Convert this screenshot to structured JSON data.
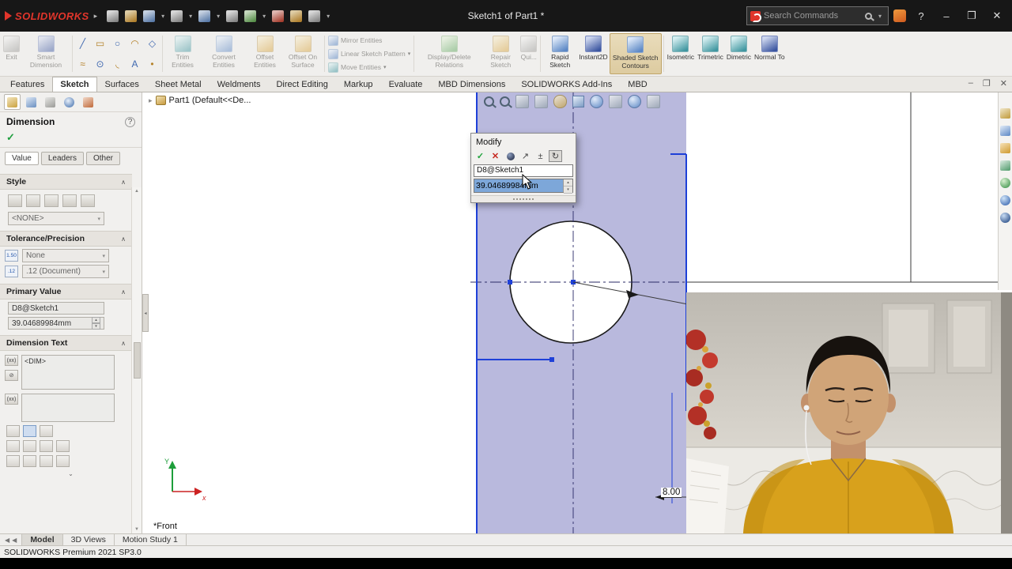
{
  "titlebar": {
    "app_name": "SOLIDWORKS",
    "title": "Sketch1 of Part1 *",
    "search_placeholder": "Search Commands"
  },
  "icons": {
    "flyout_arrow": "▸",
    "dropdown": "▾",
    "section_collapse": "∧",
    "panel_expand": "⌄",
    "check": "✓",
    "close": "✕",
    "minimize": "–",
    "restore": "❐",
    "question": "?",
    "scroll_up": "▲",
    "scroll_down": "▼",
    "nav_first": "◀",
    "nav_prev": "◀",
    "splitter_collapse": "◂",
    "spin_up": "▴",
    "spin_down": "▾",
    "arrow_ne": "↗",
    "plus_minus": "±",
    "spinner": "↻",
    "tools": [
      "╱",
      "▭",
      "○",
      "◠",
      "◇",
      "≈",
      "⊙",
      "◟",
      "A",
      "•"
    ]
  },
  "ribbon": {
    "buttons": [
      {
        "label": "Exit"
      },
      {
        "label": "Smart Dimension"
      },
      {
        "label": "Trim Entities"
      },
      {
        "label": "Convert Entities"
      },
      {
        "label": "Offset Entities"
      },
      {
        "label": "Offset On Surface"
      },
      {
        "label": "Mirror Entities"
      },
      {
        "label": "Linear Sketch Pattern"
      },
      {
        "label": "Move Entities"
      },
      {
        "label": "Display/Delete Relations"
      },
      {
        "label": "Repair Sketch"
      },
      {
        "label": "Qui..."
      },
      {
        "label": "Rapid Sketch"
      },
      {
        "label": "Instant2D"
      },
      {
        "label": "Shaded Sketch Contours"
      },
      {
        "label": "Isometric"
      },
      {
        "label": "Trimetric"
      },
      {
        "label": "Dimetric"
      },
      {
        "label": "Normal To"
      }
    ]
  },
  "command_tabs": [
    {
      "label": "Features"
    },
    {
      "label": "Sketch"
    },
    {
      "label": "Surfaces"
    },
    {
      "label": "Sheet Metal"
    },
    {
      "label": "Weldments"
    },
    {
      "label": "Direct Editing"
    },
    {
      "label": "Markup"
    },
    {
      "label": "Evaluate"
    },
    {
      "label": "MBD Dimensions"
    },
    {
      "label": "SOLIDWORKS Add-Ins"
    },
    {
      "label": "MBD"
    }
  ],
  "feature_tree": {
    "root": "Part1  (Default<<De..."
  },
  "panel": {
    "title": "Dimension",
    "tabs": [
      {
        "label": "Value"
      },
      {
        "label": "Leaders"
      },
      {
        "label": "Other"
      }
    ],
    "style": {
      "label": "Style",
      "value": "<NONE>"
    },
    "tolerance": {
      "label": "Tolerance/Precision",
      "tol_icon": "1.50",
      "tol_value": "None",
      "prec_icon": ".12",
      "precision_value": ".12 (Document)"
    },
    "primary": {
      "label": "Primary Value",
      "name": "D8@Sketch1",
      "value": "39.04689984mm"
    },
    "dimension_text": {
      "label": "Dimension Text",
      "paren_icon": "(xx)",
      "no_icon": "⊘",
      "content": "<DIM>"
    }
  },
  "modify": {
    "title": "Modify",
    "name": "D8@Sketch1",
    "value": "39.04689984mm"
  },
  "graphics": {
    "view_label": "*Front",
    "dimension_label": "8.00"
  },
  "bottom": {
    "tabs": [
      {
        "label": "Model"
      },
      {
        "label": "3D Views"
      },
      {
        "label": "Motion Study 1"
      }
    ],
    "status": "SOLIDWORKS Premium 2021 SP3.0"
  },
  "colors": {
    "accent_red": "#e1352b",
    "shaded_region": "#b9b9dd",
    "sketch_blue": "#1e40d8",
    "selection": "#7da7d9",
    "shirt_yellow": "#d8a11c"
  }
}
